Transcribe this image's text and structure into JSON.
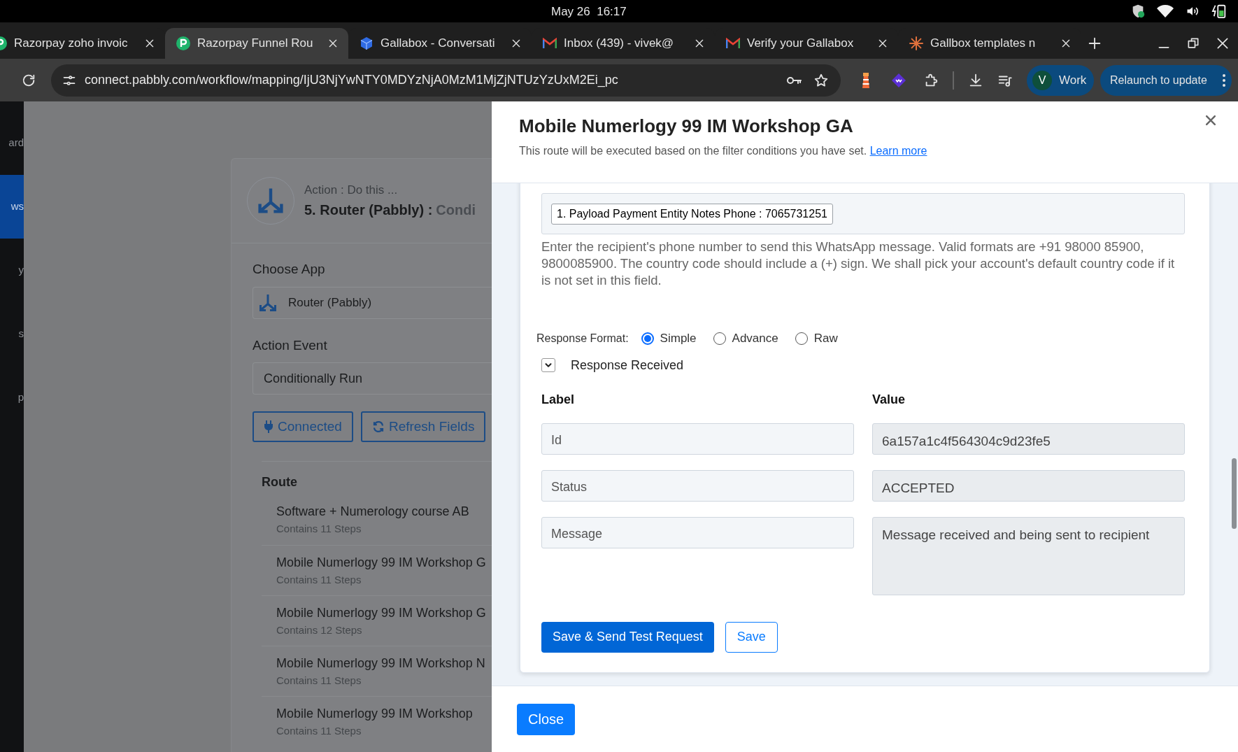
{
  "system_bar": {
    "clock": "May 26  16:17"
  },
  "tabs": [
    {
      "title": "Razorpay zoho invoic",
      "kind": "pabbly",
      "selected": false
    },
    {
      "title": "Razorpay Funnel Rou",
      "kind": "pabbly",
      "selected": true
    },
    {
      "title": "Gallabox - Conversati",
      "kind": "cube",
      "selected": false
    },
    {
      "title": "Inbox (439) - vivek@",
      "kind": "mail",
      "selected": false
    },
    {
      "title": "Verify your Gallabox",
      "kind": "mail",
      "selected": false
    },
    {
      "title": "Gallbox templates n",
      "kind": "burst",
      "selected": false
    }
  ],
  "address_bar": {
    "url": "connect.pabbly.com/workflow/mapping/IjU3NjYwNTY0MDYzNjA0MzM1MjZjNTUzYzUxM2Ei_pc"
  },
  "profile": {
    "initial": "V",
    "label": "Work"
  },
  "update_button": "Relaunch to update",
  "sidebar": {
    "items": [
      {
        "label": "ard",
        "selected": false
      },
      {
        "label": "ws",
        "selected": true
      },
      {
        "label": "y",
        "selected": false
      },
      {
        "label": "s",
        "selected": false
      },
      {
        "label": "p",
        "selected": false
      }
    ]
  },
  "action_card": {
    "subtitle": "Action : Do this ...",
    "title": "5. Router (Pabbly) :",
    "title_suffix": "Condi",
    "choose_app": {
      "label": "Choose App",
      "value": "Router (Pabbly)"
    },
    "action_event": {
      "label": "Action Event",
      "value": "Conditionally Run"
    },
    "buttons": [
      {
        "label": "Connected",
        "kind": "plug"
      },
      {
        "label": "Refresh Fields",
        "kind": "refresh"
      }
    ],
    "route": {
      "heading": "Route",
      "items": [
        {
          "title": "Software + Numerology course AB",
          "steps": "Contains 11 Steps"
        },
        {
          "title": "Mobile Numerlogy 99 IM Workshop G",
          "steps": "Contains 11 Steps"
        },
        {
          "title": "Mobile Numerlogy 99 IM Workshop G",
          "steps": "Contains 12 Steps"
        },
        {
          "title": "Mobile Numerlogy 99 IM Workshop N",
          "steps": "Contains 11 Steps"
        },
        {
          "title": "Mobile Numerlogy 99 IM Workshop",
          "steps": "Contains 11 Steps"
        }
      ]
    }
  },
  "modal": {
    "title": "Mobile Numerlogy 99 IM Workshop GA",
    "subtitle": "This route will be executed based on the filter conditions you have set.",
    "link": "Learn more",
    "phone_token": "1. Payload Payment Entity Notes Phone : 7065731251",
    "help": "Enter the recipient's phone number to send this WhatsApp message. Valid formats are +91 98000 85900, 9800085900. The country code should include a (+) sign. We shall pick your account's default country code if it is not set in this field.",
    "response_format": {
      "label": "Response Format:",
      "options": [
        {
          "label": "Simple",
          "selected": true
        },
        {
          "label": "Advance",
          "selected": false
        },
        {
          "label": "Raw",
          "selected": false
        }
      ]
    },
    "response": {
      "title": "Response Received",
      "expanded": true,
      "columns": [
        "Label",
        "Value"
      ],
      "rows": [
        {
          "label": "Id",
          "value": "6a157a1c4f564304c9d23fe5"
        },
        {
          "label": "Status",
          "value": "ACCEPTED"
        },
        {
          "label": "Message",
          "value": "Message received and being sent to recipient"
        }
      ]
    },
    "actions": [
      {
        "label": "Save & Send Test Request",
        "kind": "primary"
      },
      {
        "label": "Save",
        "kind": "outline"
      }
    ],
    "close": "Close"
  }
}
